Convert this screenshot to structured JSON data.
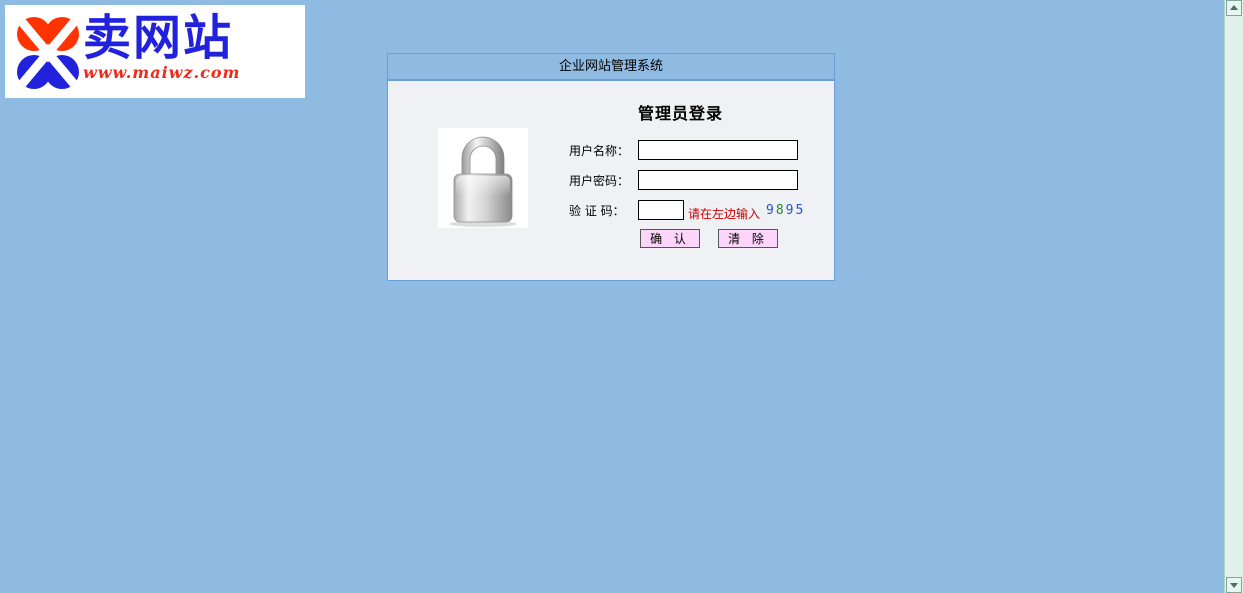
{
  "logo": {
    "brand_text": "卖网站",
    "url_text": "www.maiwz.com",
    "colors": {
      "x_red": "#ff3300",
      "x_blue": "#2222dd",
      "url": "#ee2a1a"
    }
  },
  "panel": {
    "header_title": "企业网站管理系统",
    "lock_icon": "padlock-icon",
    "form_title": "管理员登录",
    "username_label": "用户名称：",
    "username_value": "",
    "password_label": "用户密码：",
    "password_value": "",
    "captcha_label": "验 证 码：",
    "captcha_value": "",
    "captcha_hint": "请在左边输入",
    "captcha_digits": [
      "9",
      "8",
      "9",
      "5"
    ],
    "captcha_colors": [
      "#2255cc",
      "#228833",
      "#2255cc",
      "#2255cc"
    ],
    "confirm_label": "确 认",
    "clear_label": "清 除"
  },
  "colors": {
    "page_background": "#8fbbe3",
    "panel_body": "#eff1f4",
    "panel_border": "#6a9ed6",
    "button_fill": "#fcd6fa",
    "hint_red": "#cc0000"
  },
  "scrollbar": {
    "up_icon": "scroll-up-arrow-icon",
    "down_icon": "scroll-down-arrow-icon"
  }
}
